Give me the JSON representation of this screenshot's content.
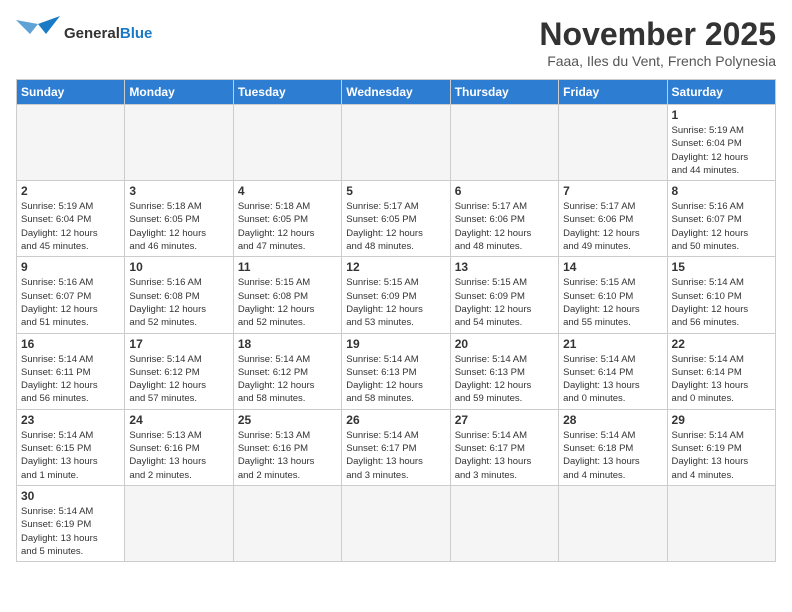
{
  "header": {
    "logo_general": "General",
    "logo_blue": "Blue",
    "month_title": "November 2025",
    "subtitle": "Faaa, Iles du Vent, French Polynesia"
  },
  "days_of_week": [
    "Sunday",
    "Monday",
    "Tuesday",
    "Wednesday",
    "Thursday",
    "Friday",
    "Saturday"
  ],
  "weeks": [
    [
      {
        "day": "",
        "info": ""
      },
      {
        "day": "",
        "info": ""
      },
      {
        "day": "",
        "info": ""
      },
      {
        "day": "",
        "info": ""
      },
      {
        "day": "",
        "info": ""
      },
      {
        "day": "",
        "info": ""
      },
      {
        "day": "1",
        "info": "Sunrise: 5:19 AM\nSunset: 6:04 PM\nDaylight: 12 hours\nand 44 minutes."
      }
    ],
    [
      {
        "day": "2",
        "info": "Sunrise: 5:19 AM\nSunset: 6:04 PM\nDaylight: 12 hours\nand 45 minutes."
      },
      {
        "day": "3",
        "info": "Sunrise: 5:18 AM\nSunset: 6:05 PM\nDaylight: 12 hours\nand 46 minutes."
      },
      {
        "day": "4",
        "info": "Sunrise: 5:18 AM\nSunset: 6:05 PM\nDaylight: 12 hours\nand 47 minutes."
      },
      {
        "day": "5",
        "info": "Sunrise: 5:17 AM\nSunset: 6:05 PM\nDaylight: 12 hours\nand 48 minutes."
      },
      {
        "day": "6",
        "info": "Sunrise: 5:17 AM\nSunset: 6:06 PM\nDaylight: 12 hours\nand 48 minutes."
      },
      {
        "day": "7",
        "info": "Sunrise: 5:17 AM\nSunset: 6:06 PM\nDaylight: 12 hours\nand 49 minutes."
      },
      {
        "day": "8",
        "info": "Sunrise: 5:16 AM\nSunset: 6:07 PM\nDaylight: 12 hours\nand 50 minutes."
      }
    ],
    [
      {
        "day": "9",
        "info": "Sunrise: 5:16 AM\nSunset: 6:07 PM\nDaylight: 12 hours\nand 51 minutes."
      },
      {
        "day": "10",
        "info": "Sunrise: 5:16 AM\nSunset: 6:08 PM\nDaylight: 12 hours\nand 52 minutes."
      },
      {
        "day": "11",
        "info": "Sunrise: 5:15 AM\nSunset: 6:08 PM\nDaylight: 12 hours\nand 52 minutes."
      },
      {
        "day": "12",
        "info": "Sunrise: 5:15 AM\nSunset: 6:09 PM\nDaylight: 12 hours\nand 53 minutes."
      },
      {
        "day": "13",
        "info": "Sunrise: 5:15 AM\nSunset: 6:09 PM\nDaylight: 12 hours\nand 54 minutes."
      },
      {
        "day": "14",
        "info": "Sunrise: 5:15 AM\nSunset: 6:10 PM\nDaylight: 12 hours\nand 55 minutes."
      },
      {
        "day": "15",
        "info": "Sunrise: 5:14 AM\nSunset: 6:10 PM\nDaylight: 12 hours\nand 56 minutes."
      }
    ],
    [
      {
        "day": "16",
        "info": "Sunrise: 5:14 AM\nSunset: 6:11 PM\nDaylight: 12 hours\nand 56 minutes."
      },
      {
        "day": "17",
        "info": "Sunrise: 5:14 AM\nSunset: 6:12 PM\nDaylight: 12 hours\nand 57 minutes."
      },
      {
        "day": "18",
        "info": "Sunrise: 5:14 AM\nSunset: 6:12 PM\nDaylight: 12 hours\nand 58 minutes."
      },
      {
        "day": "19",
        "info": "Sunrise: 5:14 AM\nSunset: 6:13 PM\nDaylight: 12 hours\nand 58 minutes."
      },
      {
        "day": "20",
        "info": "Sunrise: 5:14 AM\nSunset: 6:13 PM\nDaylight: 12 hours\nand 59 minutes."
      },
      {
        "day": "21",
        "info": "Sunrise: 5:14 AM\nSunset: 6:14 PM\nDaylight: 13 hours\nand 0 minutes."
      },
      {
        "day": "22",
        "info": "Sunrise: 5:14 AM\nSunset: 6:14 PM\nDaylight: 13 hours\nand 0 minutes."
      }
    ],
    [
      {
        "day": "23",
        "info": "Sunrise: 5:14 AM\nSunset: 6:15 PM\nDaylight: 13 hours\nand 1 minute."
      },
      {
        "day": "24",
        "info": "Sunrise: 5:13 AM\nSunset: 6:16 PM\nDaylight: 13 hours\nand 2 minutes."
      },
      {
        "day": "25",
        "info": "Sunrise: 5:13 AM\nSunset: 6:16 PM\nDaylight: 13 hours\nand 2 minutes."
      },
      {
        "day": "26",
        "info": "Sunrise: 5:14 AM\nSunset: 6:17 PM\nDaylight: 13 hours\nand 3 minutes."
      },
      {
        "day": "27",
        "info": "Sunrise: 5:14 AM\nSunset: 6:17 PM\nDaylight: 13 hours\nand 3 minutes."
      },
      {
        "day": "28",
        "info": "Sunrise: 5:14 AM\nSunset: 6:18 PM\nDaylight: 13 hours\nand 4 minutes."
      },
      {
        "day": "29",
        "info": "Sunrise: 5:14 AM\nSunset: 6:19 PM\nDaylight: 13 hours\nand 4 minutes."
      }
    ],
    [
      {
        "day": "30",
        "info": "Sunrise: 5:14 AM\nSunset: 6:19 PM\nDaylight: 13 hours\nand 5 minutes."
      },
      {
        "day": "",
        "info": ""
      },
      {
        "day": "",
        "info": ""
      },
      {
        "day": "",
        "info": ""
      },
      {
        "day": "",
        "info": ""
      },
      {
        "day": "",
        "info": ""
      },
      {
        "day": "",
        "info": ""
      }
    ]
  ]
}
